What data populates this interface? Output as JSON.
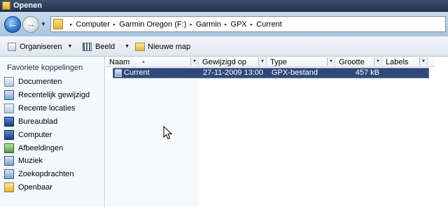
{
  "window": {
    "title": "Openen"
  },
  "nav": {
    "back_glyph": "←",
    "forward_glyph": "→",
    "history_glyph": "▼",
    "breadcrumbs": [
      "Computer",
      "Garmin Oregon (F:)",
      "Garmin",
      "GPX",
      "Current"
    ],
    "separator": "▸"
  },
  "toolbar": {
    "organize_label": "Organiseren",
    "views_label": "Beeld",
    "new_folder_label": "Nieuwe map",
    "dropdown_glyph": "▼"
  },
  "sidebar": {
    "heading": "Favoriete koppelingen",
    "items": [
      {
        "label": "Documenten",
        "icon": "documents-icon"
      },
      {
        "label": "Recentelijk gewijzigd",
        "icon": "recently-changed-icon"
      },
      {
        "label": "Recente locaties",
        "icon": "recent-places-icon"
      },
      {
        "label": "Bureaublad",
        "icon": "desktop-icon"
      },
      {
        "label": "Computer",
        "icon": "computer-icon"
      },
      {
        "label": "Afbeeldingen",
        "icon": "pictures-icon"
      },
      {
        "label": "Muziek",
        "icon": "music-icon"
      },
      {
        "label": "Zoekopdrachten",
        "icon": "searches-icon"
      },
      {
        "label": "Openbaar",
        "icon": "public-folder-icon"
      }
    ]
  },
  "file_list": {
    "columns": [
      "Naam",
      "Gewijzigd op",
      "Type",
      "Grootte",
      "Labels"
    ],
    "sort_glyph": "▲",
    "dropdown_glyph": "▼",
    "rows": [
      {
        "name": "Current",
        "modified": "27-11-2009 13:00",
        "type": "GPX-bestand",
        "size": "457 kB",
        "labels": "",
        "selected": true
      }
    ]
  },
  "colors": {
    "selection": "#31497a",
    "title_bar": "#22324d",
    "nav_bar": "#b7cfe6"
  }
}
